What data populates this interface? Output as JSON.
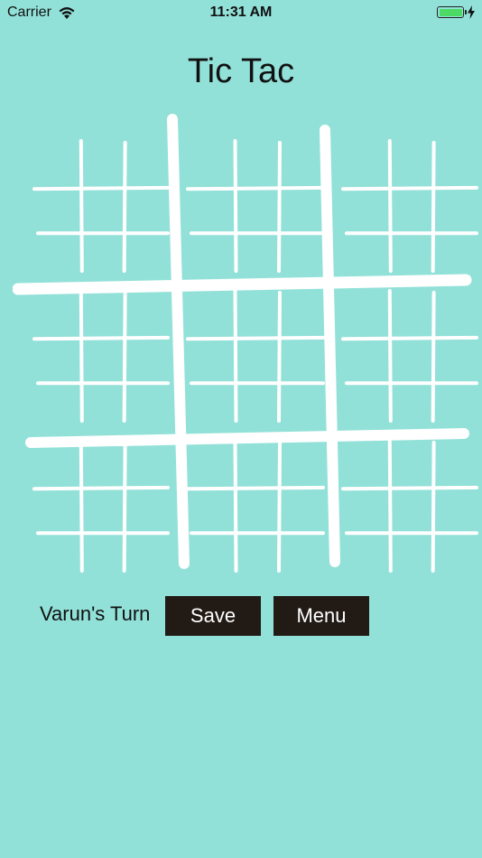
{
  "status_bar": {
    "carrier": "Carrier",
    "time": "11:31 AM",
    "battery_level": 1.0,
    "battery_color": "#4cd964"
  },
  "game": {
    "title": "Tic Tac",
    "turn_text": "Varun's Turn",
    "board": {
      "outer_grid": "3x3",
      "inner_grid": "3x3",
      "cells": [
        [
          "",
          "",
          "",
          "",
          "",
          "",
          "",
          "",
          ""
        ],
        [
          "",
          "",
          "",
          "",
          "",
          "",
          "",
          "",
          ""
        ],
        [
          "",
          "",
          "",
          "",
          "",
          "",
          "",
          "",
          ""
        ],
        [
          "",
          "",
          "",
          "",
          "",
          "",
          "",
          "",
          ""
        ],
        [
          "",
          "",
          "",
          "",
          "",
          "",
          "",
          "",
          ""
        ],
        [
          "",
          "",
          "",
          "",
          "",
          "",
          "",
          "",
          ""
        ],
        [
          "",
          "",
          "",
          "",
          "",
          "",
          "",
          "",
          ""
        ],
        [
          "",
          "",
          "",
          "",
          "",
          "",
          "",
          "",
          ""
        ],
        [
          "",
          "",
          "",
          "",
          "",
          "",
          "",
          "",
          ""
        ]
      ],
      "line_color": "#ffffff"
    }
  },
  "actions": {
    "save_label": "Save",
    "menu_label": "Menu"
  },
  "colors": {
    "background": "#92e1d8",
    "button_bg": "#211a15",
    "button_text": "#ffffff"
  }
}
